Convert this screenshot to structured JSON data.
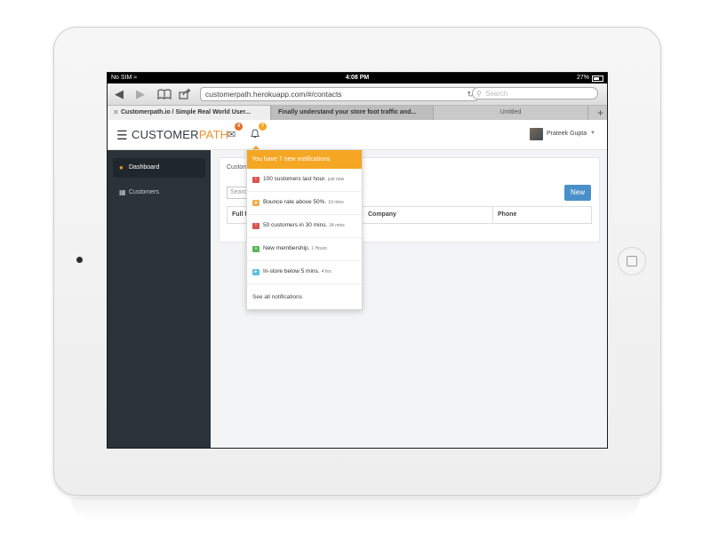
{
  "status_bar": {
    "carrier": "No SIM",
    "wifi_icon": "wifi-icon",
    "time": "4:08 PM",
    "battery": "27%"
  },
  "browser": {
    "url": "customerpath.herokuapp.com/#/contacts",
    "search_placeholder": "Search",
    "tabs": [
      {
        "label": "Customerpath.io / Simple Real World User...",
        "active": true
      },
      {
        "label": "Finally understand your store foot traffic and...",
        "active": false
      },
      {
        "label": "Untitled",
        "active": false
      }
    ]
  },
  "app": {
    "brand_part1": "CUSTOMER",
    "brand_part2": "PATH",
    "mail_badge": "4",
    "bell_badge": "7",
    "user_name": "Prateek Gupta"
  },
  "sidebar": {
    "items": [
      {
        "label": "Dashboard",
        "icon": "dashboard-icon",
        "active": true
      },
      {
        "label": "Customers",
        "icon": "grid-icon",
        "active": false
      }
    ]
  },
  "main": {
    "card_title": "Custom",
    "search_placeholder": "Search",
    "new_button": "New",
    "columns": [
      "Full N",
      "Company",
      "Phone"
    ]
  },
  "notifications": {
    "header": "You have 7 new notifications",
    "items": [
      {
        "text": "100 customers last hour.",
        "time": "just now",
        "color": "#d9534f"
      },
      {
        "text": "Bounce rate above 50%.",
        "time": "10 mins",
        "color": "#f0ad4e"
      },
      {
        "text": "50 customers in 30 mins.",
        "time": "34 mins",
        "color": "#d9534f"
      },
      {
        "text": "New membership.",
        "time": "1 Hours",
        "color": "#5cb85c"
      },
      {
        "text": "In-store below 5 mins.",
        "time": "4 hrs",
        "color": "#5bc0de"
      }
    ],
    "footer": "See all notifications"
  },
  "colors": {
    "accent": "#f5a623",
    "brand_dark": "#2f3a44",
    "brand_orange": "#f0932b",
    "sidebar_bg": "#2b3238",
    "primary_button": "#4a90c8",
    "mail_badge": "#e8702a",
    "bell_badge": "#f5a623"
  }
}
